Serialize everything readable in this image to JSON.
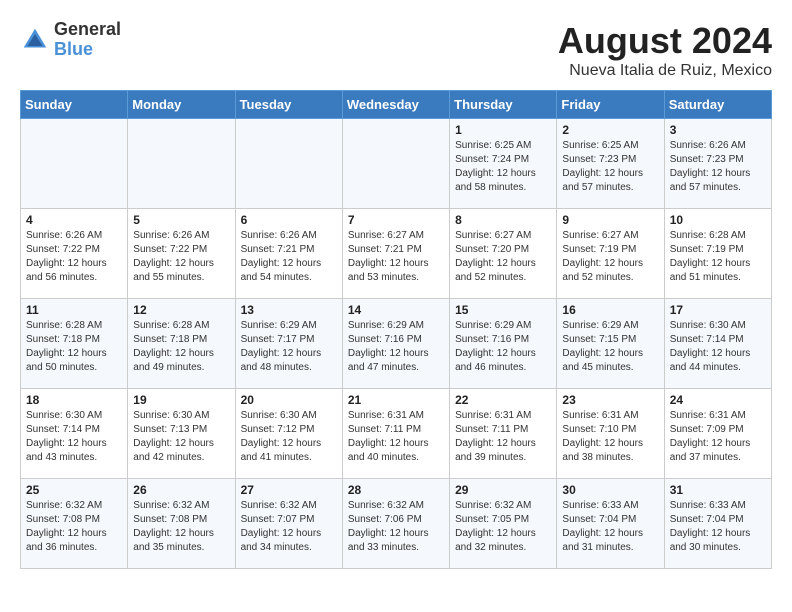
{
  "logo": {
    "general": "General",
    "blue": "Blue"
  },
  "header": {
    "month_year": "August 2024",
    "location": "Nueva Italia de Ruiz, Mexico"
  },
  "days_of_week": [
    "Sunday",
    "Monday",
    "Tuesday",
    "Wednesday",
    "Thursday",
    "Friday",
    "Saturday"
  ],
  "weeks": [
    [
      {
        "day": "",
        "info": ""
      },
      {
        "day": "",
        "info": ""
      },
      {
        "day": "",
        "info": ""
      },
      {
        "day": "",
        "info": ""
      },
      {
        "day": "1",
        "info": "Sunrise: 6:25 AM\nSunset: 7:24 PM\nDaylight: 12 hours\nand 58 minutes."
      },
      {
        "day": "2",
        "info": "Sunrise: 6:25 AM\nSunset: 7:23 PM\nDaylight: 12 hours\nand 57 minutes."
      },
      {
        "day": "3",
        "info": "Sunrise: 6:26 AM\nSunset: 7:23 PM\nDaylight: 12 hours\nand 57 minutes."
      }
    ],
    [
      {
        "day": "4",
        "info": "Sunrise: 6:26 AM\nSunset: 7:22 PM\nDaylight: 12 hours\nand 56 minutes."
      },
      {
        "day": "5",
        "info": "Sunrise: 6:26 AM\nSunset: 7:22 PM\nDaylight: 12 hours\nand 55 minutes."
      },
      {
        "day": "6",
        "info": "Sunrise: 6:26 AM\nSunset: 7:21 PM\nDaylight: 12 hours\nand 54 minutes."
      },
      {
        "day": "7",
        "info": "Sunrise: 6:27 AM\nSunset: 7:21 PM\nDaylight: 12 hours\nand 53 minutes."
      },
      {
        "day": "8",
        "info": "Sunrise: 6:27 AM\nSunset: 7:20 PM\nDaylight: 12 hours\nand 52 minutes."
      },
      {
        "day": "9",
        "info": "Sunrise: 6:27 AM\nSunset: 7:19 PM\nDaylight: 12 hours\nand 52 minutes."
      },
      {
        "day": "10",
        "info": "Sunrise: 6:28 AM\nSunset: 7:19 PM\nDaylight: 12 hours\nand 51 minutes."
      }
    ],
    [
      {
        "day": "11",
        "info": "Sunrise: 6:28 AM\nSunset: 7:18 PM\nDaylight: 12 hours\nand 50 minutes."
      },
      {
        "day": "12",
        "info": "Sunrise: 6:28 AM\nSunset: 7:18 PM\nDaylight: 12 hours\nand 49 minutes."
      },
      {
        "day": "13",
        "info": "Sunrise: 6:29 AM\nSunset: 7:17 PM\nDaylight: 12 hours\nand 48 minutes."
      },
      {
        "day": "14",
        "info": "Sunrise: 6:29 AM\nSunset: 7:16 PM\nDaylight: 12 hours\nand 47 minutes."
      },
      {
        "day": "15",
        "info": "Sunrise: 6:29 AM\nSunset: 7:16 PM\nDaylight: 12 hours\nand 46 minutes."
      },
      {
        "day": "16",
        "info": "Sunrise: 6:29 AM\nSunset: 7:15 PM\nDaylight: 12 hours\nand 45 minutes."
      },
      {
        "day": "17",
        "info": "Sunrise: 6:30 AM\nSunset: 7:14 PM\nDaylight: 12 hours\nand 44 minutes."
      }
    ],
    [
      {
        "day": "18",
        "info": "Sunrise: 6:30 AM\nSunset: 7:14 PM\nDaylight: 12 hours\nand 43 minutes."
      },
      {
        "day": "19",
        "info": "Sunrise: 6:30 AM\nSunset: 7:13 PM\nDaylight: 12 hours\nand 42 minutes."
      },
      {
        "day": "20",
        "info": "Sunrise: 6:30 AM\nSunset: 7:12 PM\nDaylight: 12 hours\nand 41 minutes."
      },
      {
        "day": "21",
        "info": "Sunrise: 6:31 AM\nSunset: 7:11 PM\nDaylight: 12 hours\nand 40 minutes."
      },
      {
        "day": "22",
        "info": "Sunrise: 6:31 AM\nSunset: 7:11 PM\nDaylight: 12 hours\nand 39 minutes."
      },
      {
        "day": "23",
        "info": "Sunrise: 6:31 AM\nSunset: 7:10 PM\nDaylight: 12 hours\nand 38 minutes."
      },
      {
        "day": "24",
        "info": "Sunrise: 6:31 AM\nSunset: 7:09 PM\nDaylight: 12 hours\nand 37 minutes."
      }
    ],
    [
      {
        "day": "25",
        "info": "Sunrise: 6:32 AM\nSunset: 7:08 PM\nDaylight: 12 hours\nand 36 minutes."
      },
      {
        "day": "26",
        "info": "Sunrise: 6:32 AM\nSunset: 7:08 PM\nDaylight: 12 hours\nand 35 minutes."
      },
      {
        "day": "27",
        "info": "Sunrise: 6:32 AM\nSunset: 7:07 PM\nDaylight: 12 hours\nand 34 minutes."
      },
      {
        "day": "28",
        "info": "Sunrise: 6:32 AM\nSunset: 7:06 PM\nDaylight: 12 hours\nand 33 minutes."
      },
      {
        "day": "29",
        "info": "Sunrise: 6:32 AM\nSunset: 7:05 PM\nDaylight: 12 hours\nand 32 minutes."
      },
      {
        "day": "30",
        "info": "Sunrise: 6:33 AM\nSunset: 7:04 PM\nDaylight: 12 hours\nand 31 minutes."
      },
      {
        "day": "31",
        "info": "Sunrise: 6:33 AM\nSunset: 7:04 PM\nDaylight: 12 hours\nand 30 minutes."
      }
    ]
  ]
}
